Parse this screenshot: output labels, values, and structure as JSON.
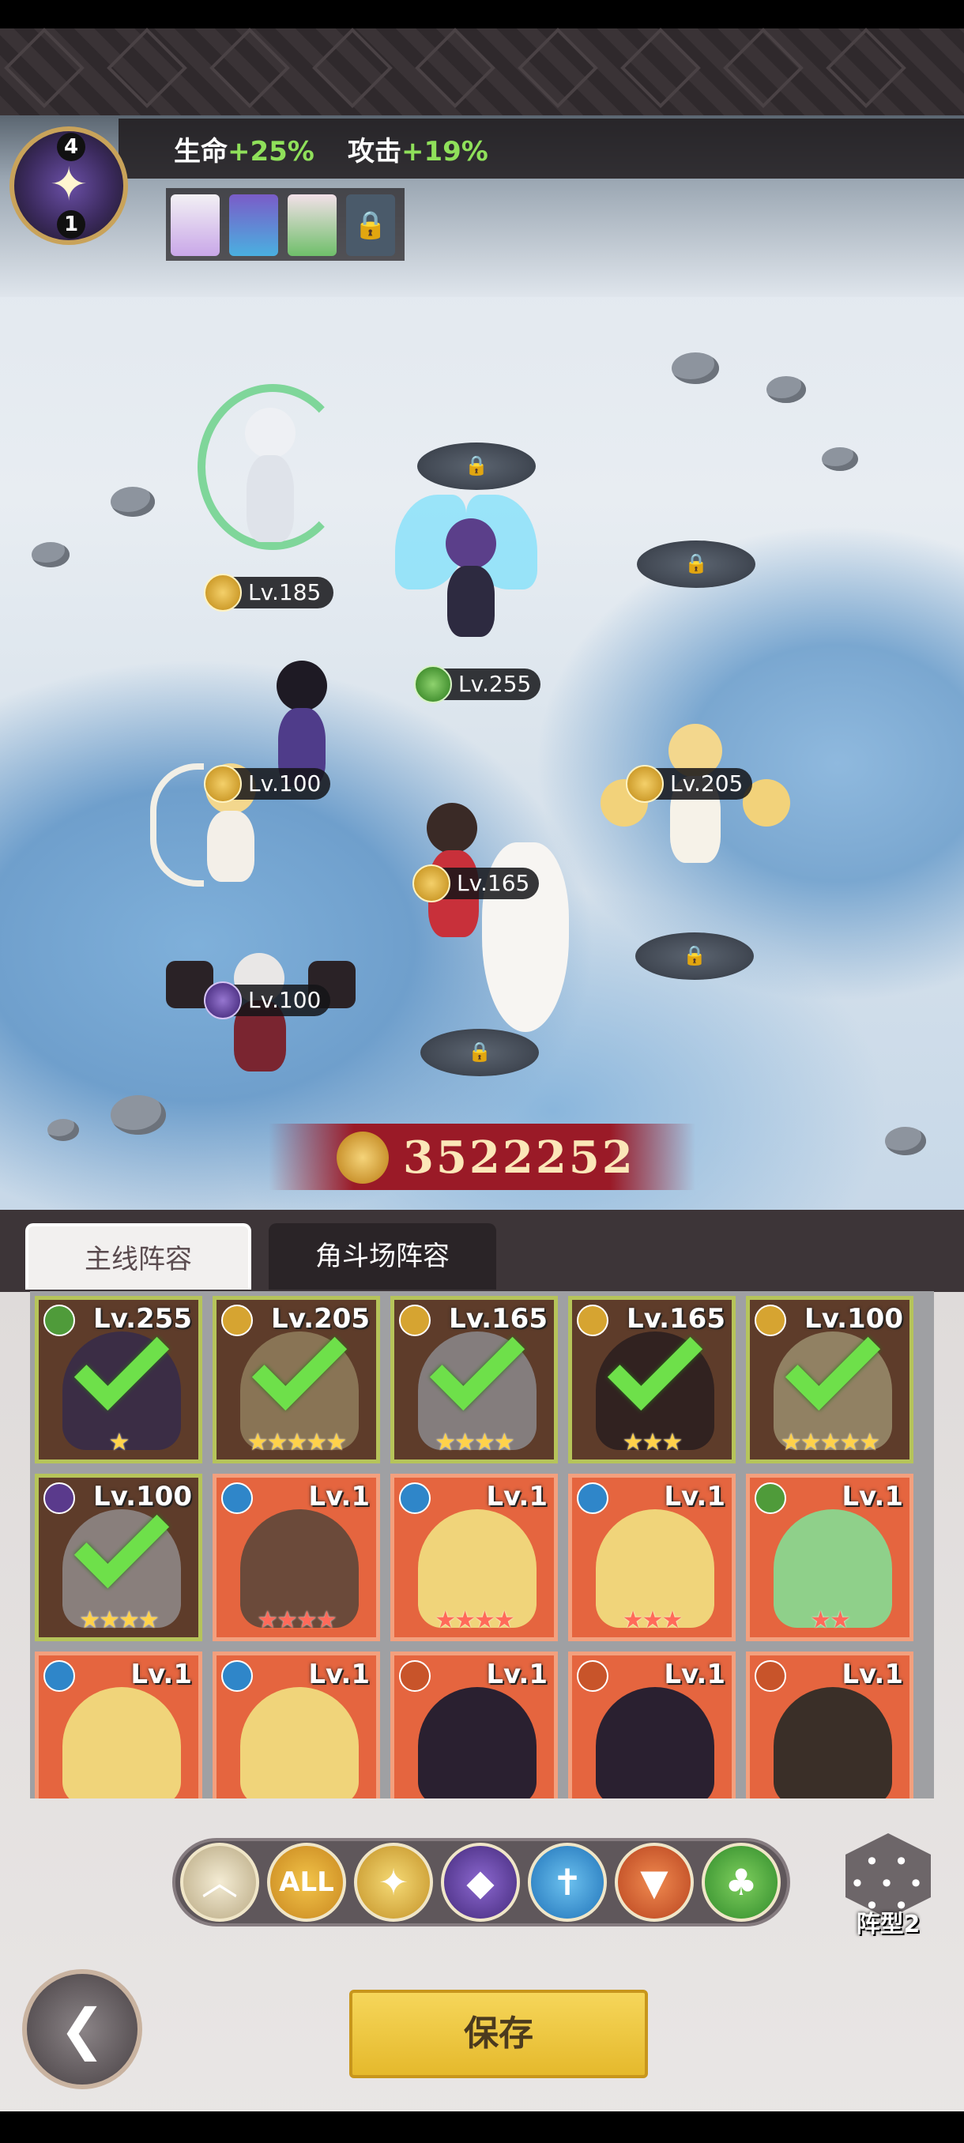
{
  "bonus": {
    "hp_label": "生命",
    "hp_value": "+25%",
    "atk_label": "攻击",
    "atk_value": "+19%"
  },
  "emblem": {
    "top_number": "4",
    "bottom_number": "1"
  },
  "battlefield": {
    "heroes": [
      {
        "level": "Lv.185"
      },
      {
        "level": "Lv.255"
      },
      {
        "level": "Lv.100"
      },
      {
        "level": "Lv.205"
      },
      {
        "level": "Lv.165"
      },
      {
        "level": "Lv.100"
      }
    ]
  },
  "combat_power": "3522252",
  "tabs": {
    "main": "主线阵容",
    "arena": "角斗场阵容"
  },
  "roster": [
    {
      "level": "Lv.255",
      "selected": true,
      "stars": "★",
      "element": "nature"
    },
    {
      "level": "Lv.205",
      "selected": true,
      "stars": "★★★★★",
      "element": "holy"
    },
    {
      "level": "Lv.165",
      "selected": true,
      "stars": "★★★★",
      "element": "holy"
    },
    {
      "level": "Lv.165",
      "selected": true,
      "stars": "★★★",
      "element": "holy"
    },
    {
      "level": "Lv.100",
      "selected": true,
      "stars": "★★★★★",
      "element": "holy"
    },
    {
      "level": "Lv.100",
      "selected": true,
      "stars": "★★★★",
      "element": "dark"
    },
    {
      "level": "Lv.1",
      "selected": false,
      "stars": "★★★★",
      "element": "water"
    },
    {
      "level": "Lv.1",
      "selected": false,
      "stars": "★★★★",
      "element": "water"
    },
    {
      "level": "Lv.1",
      "selected": false,
      "stars": "★★★",
      "element": "water"
    },
    {
      "level": "Lv.1",
      "selected": false,
      "stars": "★★",
      "element": "nature"
    },
    {
      "level": "Lv.1",
      "selected": false,
      "stars": "",
      "element": "water"
    },
    {
      "level": "Lv.1",
      "selected": false,
      "stars": "",
      "element": "water"
    },
    {
      "level": "Lv.1",
      "selected": false,
      "stars": "",
      "element": "fire"
    },
    {
      "level": "Lv.1",
      "selected": false,
      "stars": "",
      "element": "fire"
    },
    {
      "level": "Lv.1",
      "selected": false,
      "stars": "",
      "element": "fire"
    }
  ],
  "filters": {
    "collapse_icon": "chevron-up-icon",
    "all_label": "ALL",
    "holy_icon": "holy-icon",
    "dark_icon": "dark-icon",
    "water_icon": "water-icon",
    "fire_icon": "fire-icon",
    "nature_icon": "nature-icon"
  },
  "formation_label": "阵型2",
  "save_label": "保存",
  "colors": {
    "bonus_green": "#8fe05a",
    "save_yellow": "#f6d65a",
    "card_orange": "#e5653f",
    "check_green": "#6ee04a"
  }
}
